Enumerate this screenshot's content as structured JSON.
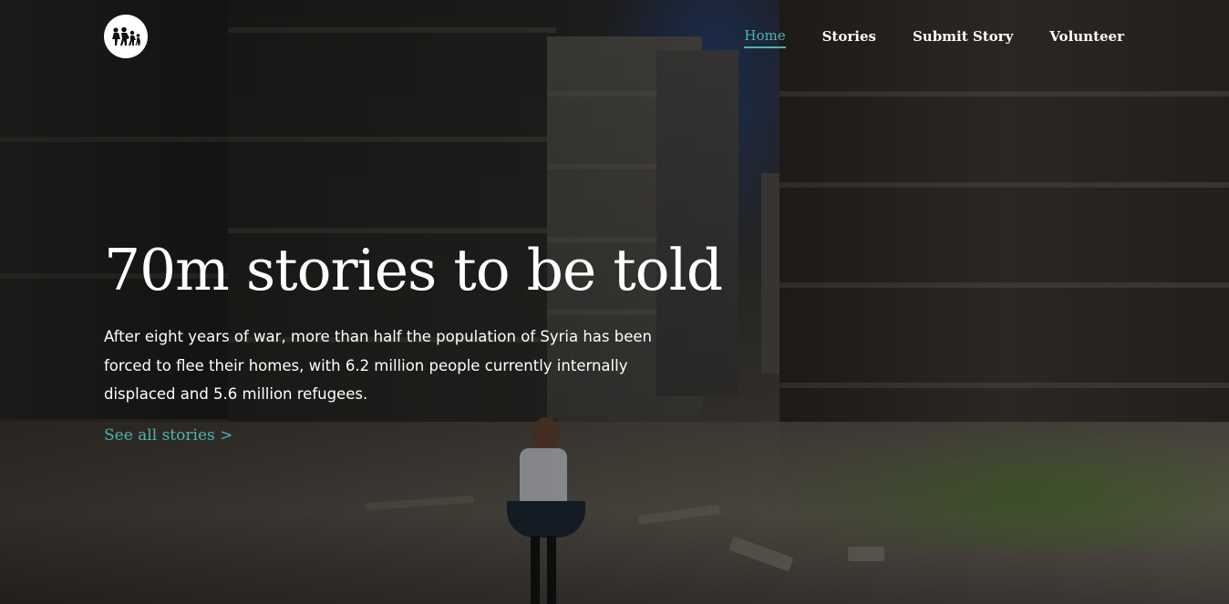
{
  "header": {
    "logo_icon": "refugee-family-icon",
    "nav": {
      "home": "Home",
      "stories": "Stories",
      "submit_story": "Submit Story",
      "volunteer": "Volunteer"
    },
    "active_item": "Home"
  },
  "hero": {
    "headline": "70m stories to be told",
    "lede": "After eight years of war, more than half the population of Syria has been forced to flee their homes, with 6.2 million people currently internally displaced and 5.6 million refugees.",
    "cta_label": "See all stories >"
  },
  "colors": {
    "accent": "#4fb3b0",
    "text": "#ffffff"
  }
}
